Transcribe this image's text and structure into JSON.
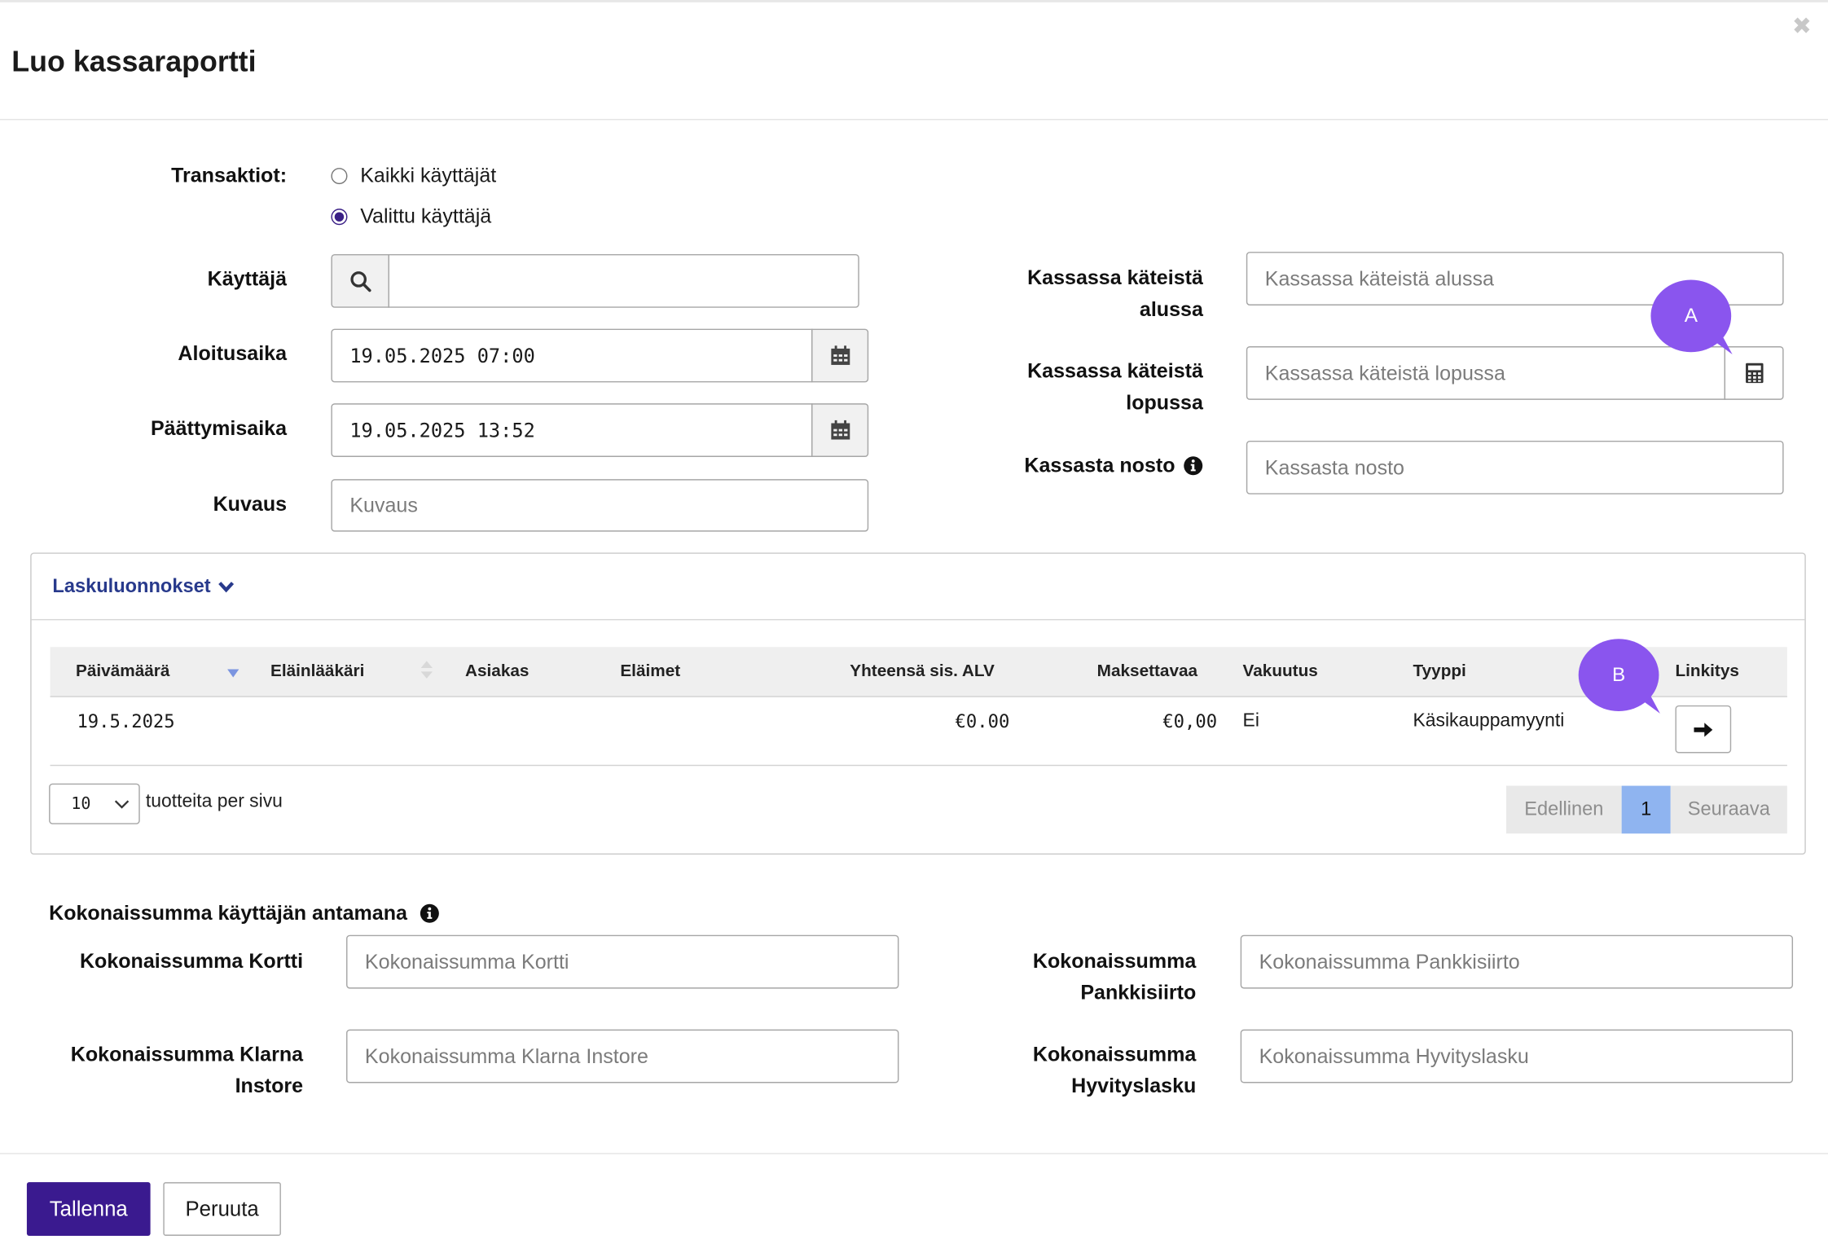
{
  "dialog": {
    "title": "Luo kassaraportti",
    "close_icon": "close-icon"
  },
  "form": {
    "transactions": {
      "label": "Transaktiot:",
      "options": [
        {
          "label": "Kaikki käyttäjät",
          "selected": false
        },
        {
          "label": "Valittu käyttäjä",
          "selected": true
        }
      ]
    },
    "user": {
      "label": "Käyttäjä",
      "value": "",
      "icon": "search-icon"
    },
    "start_time": {
      "label": "Aloitusaika",
      "value": "19.05.2025 07:00",
      "icon": "calendar-icon"
    },
    "end_time": {
      "label": "Päättymisaika",
      "value": "19.05.2025 13:52",
      "icon": "calendar-icon"
    },
    "description": {
      "label": "Kuvaus",
      "placeholder": "Kuvaus"
    },
    "cash_start": {
      "label_line1": "Kassassa käteistä",
      "label_line2": "alussa",
      "placeholder": "Kassassa käteistä alussa"
    },
    "cash_end": {
      "label_line1": "Kassassa käteistä",
      "label_line2": "lopussa",
      "placeholder": "Kassassa käteistä lopussa",
      "icon": "calculator-icon"
    },
    "withdrawal": {
      "label": "Kassasta nosto",
      "placeholder": "Kassasta nosto",
      "icon": "info-icon"
    }
  },
  "drafts": {
    "title": "Laskuluonnokset",
    "columns": [
      "Päivämäärä",
      "Eläinlääkäri",
      "Asiakas",
      "Eläimet",
      "Yhteensä sis. ALV",
      "Maksettavaa",
      "Vakuutus",
      "Tyyppi",
      "Linkitys"
    ],
    "rows": [
      {
        "date": "19.5.2025",
        "vet": "",
        "customer": "",
        "animals": "",
        "total": "€0.00",
        "payable": "€0,00",
        "insurance": "Ei",
        "type": "Käsikauppamyynti",
        "link_icon": "arrow-right-icon"
      }
    ],
    "page_size": "10",
    "page_size_label": "tuotteita per sivu",
    "pagination": {
      "prev": "Edellinen",
      "current": "1",
      "next": "Seuraava"
    }
  },
  "totals": {
    "heading": "Kokonaissumma käyttäjän antamana",
    "card": {
      "label": "Kokonaissumma Kortti",
      "placeholder": "Kokonaissumma Kortti"
    },
    "klarna": {
      "label_line1": "Kokonaissumma Klarna",
      "label_line2": "Instore",
      "placeholder": "Kokonaissumma Klarna Instore"
    },
    "bank": {
      "label_line1": "Kokonaissumma",
      "label_line2": "Pankkisiirto",
      "placeholder": "Kokonaissumma Pankkisiirto"
    },
    "credit": {
      "label_line1": "Kokonaissumma",
      "label_line2": "Hyvityslasku",
      "placeholder": "Kokonaissumma Hyvityslasku"
    }
  },
  "annotations": {
    "a": "A",
    "b": "B",
    "color": "#8a55ee"
  },
  "footer": {
    "save": "Tallenna",
    "cancel": "Peruuta"
  },
  "colors": {
    "primary": "#3a1a8f",
    "link": "#283a8c",
    "page_active": "#8fb4f0"
  }
}
